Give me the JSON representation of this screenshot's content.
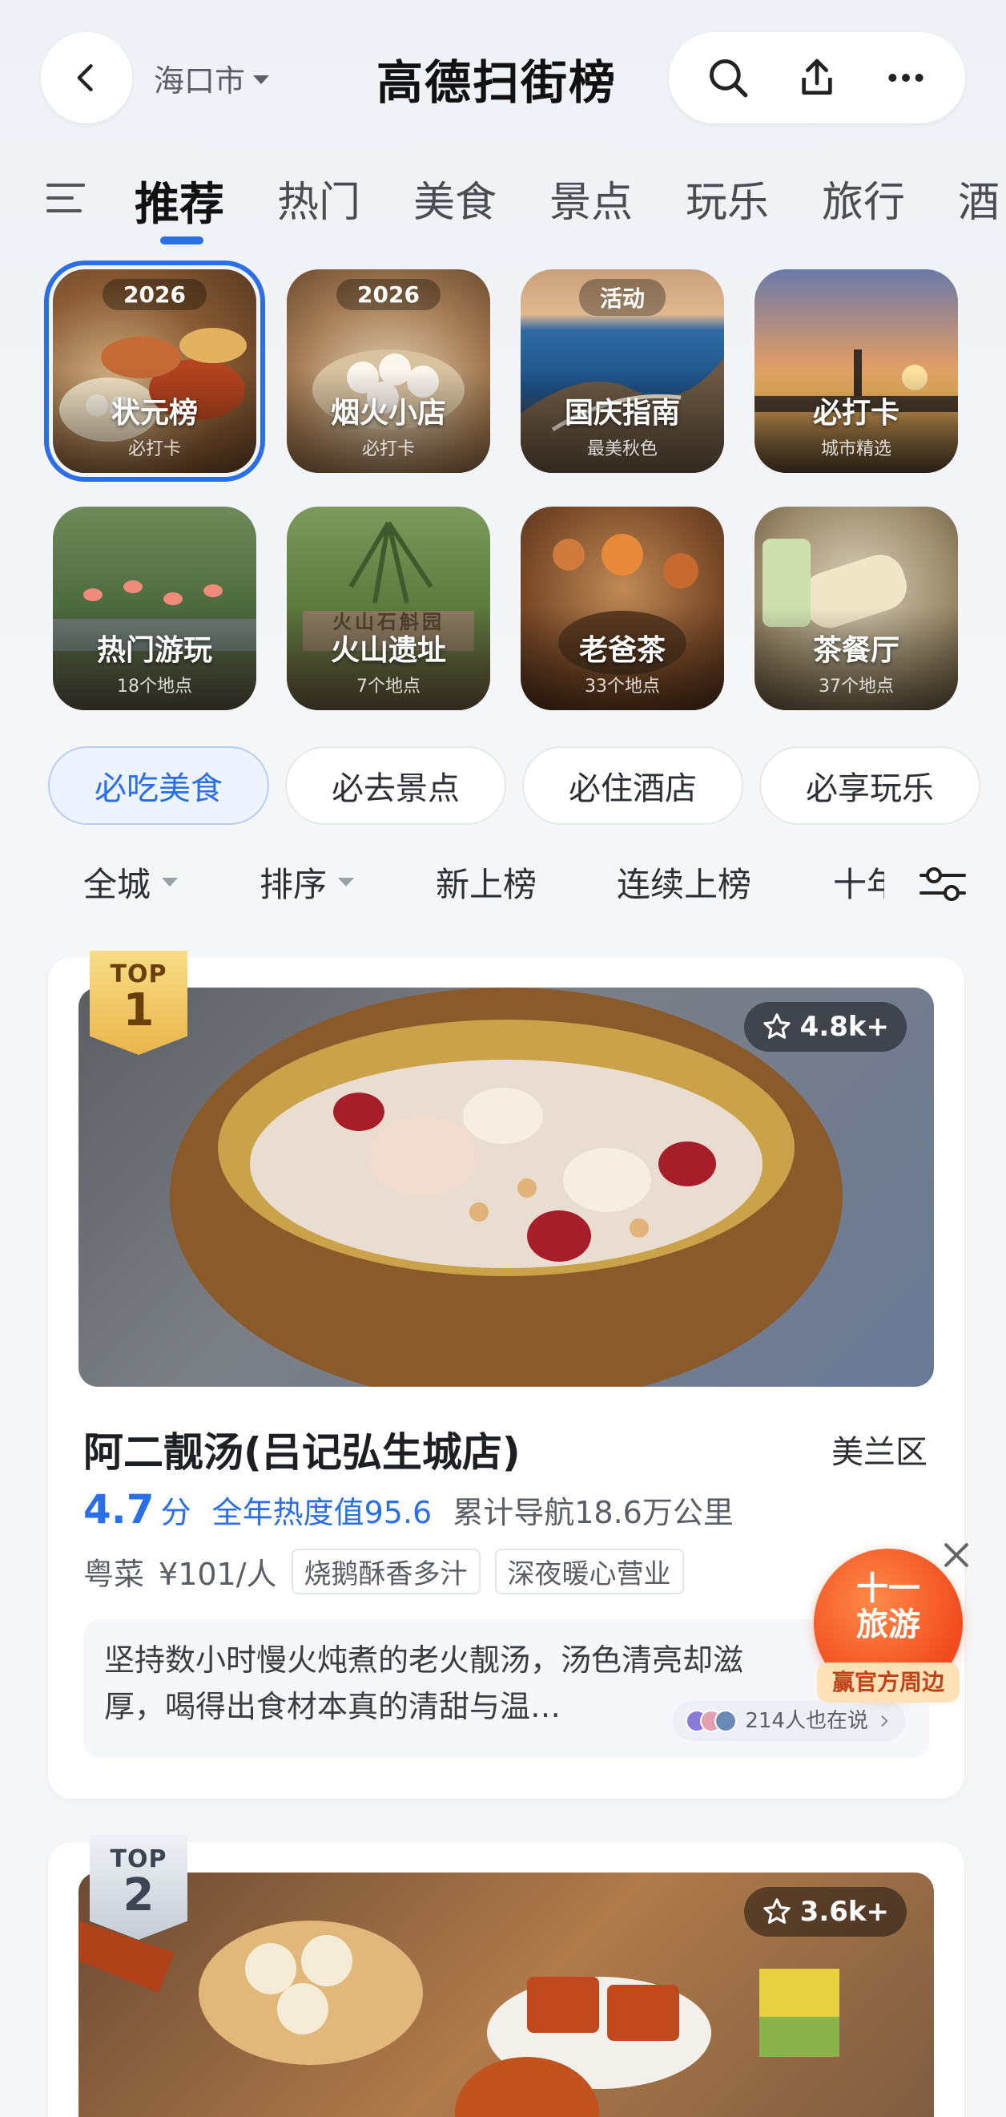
{
  "header": {
    "city": "海口市",
    "brand": "高德扫街榜"
  },
  "tabs": [
    "推荐",
    "热门",
    "美食",
    "景点",
    "玩乐",
    "旅行",
    "酒"
  ],
  "tiles": [
    {
      "title": "状元榜",
      "sub": "必打卡",
      "year": "2026"
    },
    {
      "title": "烟火小店",
      "sub": "必打卡",
      "year": "2026"
    },
    {
      "title": "国庆指南",
      "sub": "最美秋色",
      "year": "活动"
    },
    {
      "title": "必打卡",
      "sub": "城市精选"
    },
    {
      "title": "热门游玩",
      "sub": "18个地点"
    },
    {
      "title": "火山遗址",
      "sub": "7个地点",
      "sign": "火山石斛园"
    },
    {
      "title": "老爸茶",
      "sub": "33个地点"
    },
    {
      "title": "茶餐厅",
      "sub": "37个地点"
    }
  ],
  "pills": [
    "必吃美食",
    "必去景点",
    "必住酒店",
    "必享玩乐"
  ],
  "sort": {
    "all_city": "全城",
    "order": "排序",
    "new": "新上榜",
    "continuous": "连续上榜",
    "more": "十年"
  },
  "cards": [
    {
      "badge_top": "TOP",
      "rank": "1",
      "favorites": "4.8k+",
      "name": "阿二靓汤(吕记弘生城店)",
      "district": "美兰区",
      "score": "4.7",
      "score_unit": "分",
      "heat": "全年热度值95.6",
      "nav": "累计导航18.6万公里",
      "cuisine": "粤菜",
      "price": "¥101/人",
      "tags": [
        "烧鹅酥香多汁",
        "深夜暖心营业"
      ],
      "review_line1": "坚持数小时慢火炖煮的老火靓汤，汤色清亮却滋",
      "review_line2": "厚，喝得出食材本真的清甜与温…",
      "talk": "214人也在说"
    },
    {
      "badge_top": "TOP",
      "rank": "2",
      "favorites": "3.6k+"
    }
  ],
  "promo": {
    "line1": "十一",
    "line2": "旅游",
    "line3": "赢官方周边"
  },
  "colors": {
    "accent": "#2a6ee8",
    "gold": "#eab64b",
    "promo": "#f14a1c"
  }
}
